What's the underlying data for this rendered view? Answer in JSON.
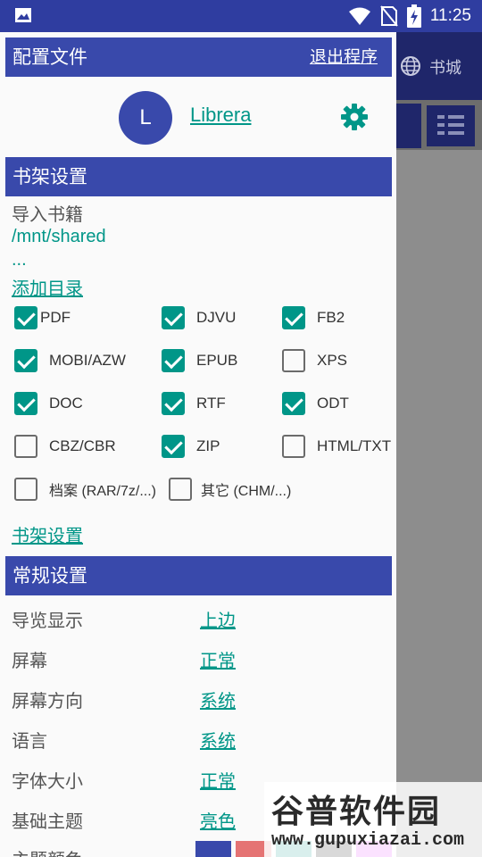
{
  "status_bar": {
    "time": "11:25",
    "icons": [
      "image-icon",
      "wifi-icon",
      "no-sim-icon",
      "battery-charging-icon"
    ]
  },
  "background_app": {
    "shop_label": "书城"
  },
  "drawer": {
    "profile_header": {
      "title": "配置文件",
      "exit_label": "退出程序"
    },
    "profile": {
      "avatar_letter": "L",
      "name": "Librera"
    },
    "library_section": {
      "title": "书架设置",
      "import_label": "导入书籍",
      "path": "/mnt/shared",
      "ellipsis": "...",
      "add_folder": "添加目录",
      "formats": [
        {
          "label": "PDF",
          "checked": true
        },
        {
          "label": "DJVU",
          "checked": true
        },
        {
          "label": "FB2",
          "checked": true
        },
        {
          "label": "MOBI/AZW",
          "checked": true
        },
        {
          "label": "EPUB",
          "checked": true
        },
        {
          "label": "XPS",
          "checked": false
        },
        {
          "label": "DOC",
          "checked": true
        },
        {
          "label": "RTF",
          "checked": true
        },
        {
          "label": "ODT",
          "checked": true
        },
        {
          "label": "CBZ/CBR",
          "checked": false
        },
        {
          "label": "ZIP",
          "checked": true
        },
        {
          "label": "HTML/TXT",
          "checked": false
        },
        {
          "label": "档案 (RAR/7z/...)",
          "checked": false
        },
        {
          "label": "其它 (CHM/...)",
          "checked": false
        }
      ],
      "library_settings_link": "书架设置"
    },
    "general_section": {
      "title": "常规设置",
      "rows": [
        {
          "label": "导览显示",
          "value": "上边"
        },
        {
          "label": "屏幕",
          "value": "正常"
        },
        {
          "label": "屏幕方向",
          "value": "系统"
        },
        {
          "label": "语言",
          "value": "系统"
        },
        {
          "label": "字体大小",
          "value": "正常"
        },
        {
          "label": "基础主题",
          "value": "亮色"
        },
        {
          "label": "主题颜色",
          "value": ""
        }
      ],
      "theme_colors": [
        "#3949ab",
        "#e57373",
        "#009688",
        "#000000",
        "#e040fb"
      ]
    }
  },
  "watermark": {
    "title": "谷普软件园",
    "url": "www.gupuxiazai.com"
  },
  "colors": {
    "accent": "#009688",
    "primary": "#3949ab",
    "status_bar": "#2f3da0"
  }
}
